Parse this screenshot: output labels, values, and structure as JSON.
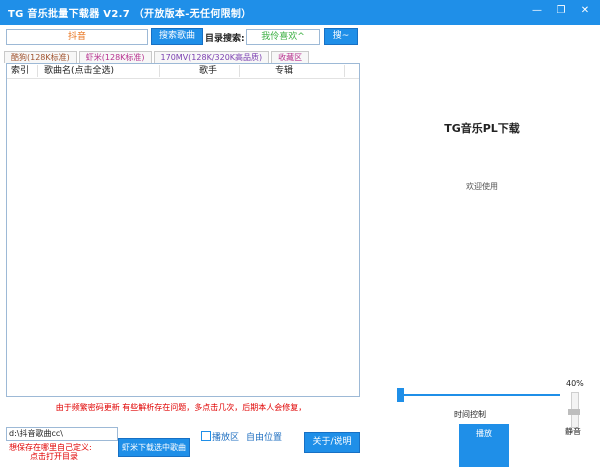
{
  "window": {
    "title": "TG 音乐批量下载器 V2.7 （开放版本-无任何限制）",
    "minimize_glyph": "—",
    "restore_glyph": "❐",
    "close_glyph": "✕"
  },
  "search": {
    "keyword_value": "抖音",
    "search_button": "搜索歌曲",
    "directory_label": "目录搜索:",
    "directory_value": "我伶喜欢^",
    "dir_search_button": "搜~"
  },
  "tabs": [
    {
      "label": "酷狗(128K标准)"
    },
    {
      "label": "虾米(128K标准)"
    },
    {
      "label": "170MV(128K/320K高品质)"
    },
    {
      "label": "收藏区"
    }
  ],
  "table": {
    "columns": [
      "索引",
      "歌曲名(点击全选)",
      "歌手",
      "专辑"
    ]
  },
  "notice": "由于频繁密码更新 有些解析存在问题，多点击几次，后期本人会修复，",
  "right": {
    "title": "TG音乐PL下载",
    "welcome": "欢迎使用",
    "volume_label": "40%",
    "time_label": "时间控制",
    "play_label": "播放",
    "mute_label": "静音",
    "volume_level": 0.4,
    "progress_level": 0.0
  },
  "bottom": {
    "path_value": "d:\\抖音歌曲cc\\",
    "hint_line1": "想保存在哪里自己定义:",
    "hint_line2": "点击打开目录",
    "download_button": "虾米下载选中歌曲",
    "play_area_label": "播放区",
    "free_position_label": "自由位置",
    "about_button": "关于/说明"
  },
  "colors": {
    "accent": "#1f8fe8",
    "notice": "#e00000",
    "keyword": "#e8721c",
    "dir_value": "#3cb043"
  }
}
